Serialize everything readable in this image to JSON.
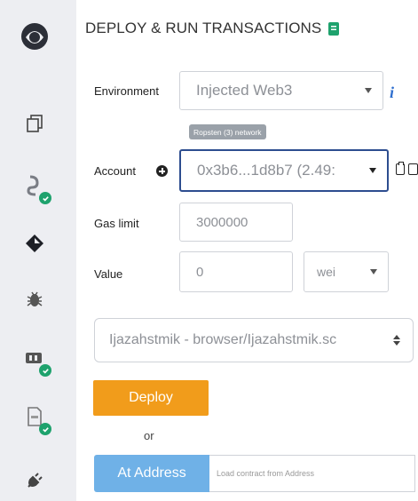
{
  "sidebar": {
    "items": [
      {
        "icon": "remix-logo-icon",
        "checked": false
      },
      {
        "icon": "file-explorer-icon",
        "checked": false
      },
      {
        "icon": "compiler-icon",
        "checked": true
      },
      {
        "icon": "deploy-run-icon",
        "checked": false
      },
      {
        "icon": "debugger-icon",
        "checked": false
      },
      {
        "icon": "testing-icon",
        "checked": true
      },
      {
        "icon": "analysis-icon",
        "checked": true
      },
      {
        "icon": "plugin-manager-icon",
        "checked": false
      }
    ]
  },
  "header": {
    "title": "DEPLOY & RUN TRANSACTIONS"
  },
  "environment": {
    "label": "Environment",
    "value": "Injected Web3",
    "network_badge": "Ropsten (3) network"
  },
  "account": {
    "label": "Account",
    "value": "0x3b6...1d8b7 (2.49:"
  },
  "gas_limit": {
    "label": "Gas limit",
    "value": "3000000"
  },
  "value": {
    "label": "Value",
    "amount": "0",
    "unit": "wei"
  },
  "contract": {
    "selected": "Ijazahstmik - browser/Ijazahstmik.sc"
  },
  "actions": {
    "deploy_label": "Deploy",
    "or_label": "or",
    "at_address_label": "At Address",
    "at_address_placeholder": "Load contract from Address"
  },
  "colors": {
    "deploy": "#f19c1b",
    "at_address": "#6fb1e7",
    "check": "#1ea26d",
    "info": "#2f6fcf"
  }
}
